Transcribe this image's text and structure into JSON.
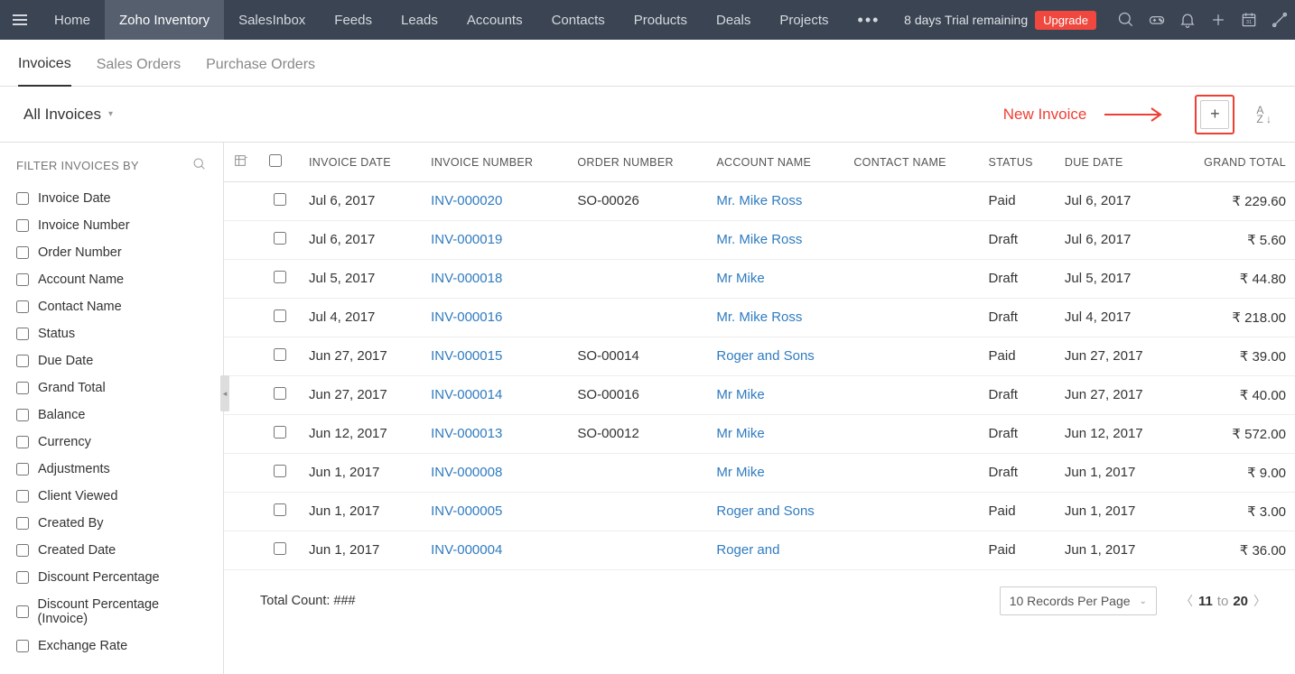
{
  "topnav": {
    "tabs": [
      "Home",
      "Zoho Inventory",
      "SalesInbox",
      "Feeds",
      "Leads",
      "Accounts",
      "Contacts",
      "Products",
      "Deals",
      "Projects"
    ],
    "active_index": 1,
    "more": "•••",
    "trial_text": "8 days Trial remaining",
    "upgrade": "Upgrade"
  },
  "subtabs": {
    "items": [
      "Invoices",
      "Sales Orders",
      "Purchase Orders"
    ],
    "active_index": 0
  },
  "toolbar": {
    "view": "All Invoices",
    "new_invoice_label": "New Invoice"
  },
  "sidebar": {
    "title": "FILTER INVOICES BY",
    "filters": [
      "Invoice Date",
      "Invoice Number",
      "Order Number",
      "Account Name",
      "Contact Name",
      "Status",
      "Due Date",
      "Grand Total",
      "Balance",
      "Currency",
      "Adjustments",
      "Client Viewed",
      "Created By",
      "Created Date",
      "Discount Percentage",
      "Discount Percentage (Invoice)",
      "Exchange Rate"
    ]
  },
  "table": {
    "headers": {
      "invoice_date": "INVOICE DATE",
      "invoice_number": "INVOICE NUMBER",
      "order_number": "ORDER NUMBER",
      "account_name": "ACCOUNT NAME",
      "contact_name": "CONTACT NAME",
      "status": "STATUS",
      "due_date": "DUE DATE",
      "grand_total": "GRAND TOTAL"
    },
    "rows": [
      {
        "date": "Jul 6, 2017",
        "num": "INV-000020",
        "order": "SO-00026",
        "account": "Mr. Mike Ross",
        "contact": "",
        "status": "Paid",
        "due": "Jul 6, 2017",
        "total": "₹ 229.60"
      },
      {
        "date": "Jul 6, 2017",
        "num": "INV-000019",
        "order": "",
        "account": "Mr. Mike Ross",
        "contact": "",
        "status": "Draft",
        "due": "Jul 6, 2017",
        "total": "₹ 5.60"
      },
      {
        "date": "Jul 5, 2017",
        "num": "INV-000018",
        "order": "",
        "account": "Mr Mike",
        "contact": "",
        "status": "Draft",
        "due": "Jul 5, 2017",
        "total": "₹ 44.80"
      },
      {
        "date": "Jul 4, 2017",
        "num": "INV-000016",
        "order": "",
        "account": "Mr. Mike Ross",
        "contact": "",
        "status": "Draft",
        "due": "Jul 4, 2017",
        "total": "₹ 218.00"
      },
      {
        "date": "Jun 27, 2017",
        "num": "INV-000015",
        "order": "SO-00014",
        "account": "Roger and Sons",
        "contact": "",
        "status": "Paid",
        "due": "Jun 27, 2017",
        "total": "₹ 39.00"
      },
      {
        "date": "Jun 27, 2017",
        "num": "INV-000014",
        "order": "SO-00016",
        "account": "Mr Mike",
        "contact": "",
        "status": "Draft",
        "due": "Jun 27, 2017",
        "total": "₹ 40.00"
      },
      {
        "date": "Jun 12, 2017",
        "num": "INV-000013",
        "order": "SO-00012",
        "account": "Mr Mike",
        "contact": "",
        "status": "Draft",
        "due": "Jun 12, 2017",
        "total": "₹ 572.00"
      },
      {
        "date": "Jun 1, 2017",
        "num": "INV-000008",
        "order": "",
        "account": "Mr Mike",
        "contact": "",
        "status": "Draft",
        "due": "Jun 1, 2017",
        "total": "₹ 9.00"
      },
      {
        "date": "Jun 1, 2017",
        "num": "INV-000005",
        "order": "",
        "account": "Roger and Sons",
        "contact": "",
        "status": "Paid",
        "due": "Jun 1, 2017",
        "total": "₹ 3.00"
      },
      {
        "date": "Jun 1, 2017",
        "num": "INV-000004",
        "order": "",
        "account": "Roger and",
        "contact": "",
        "status": "Paid",
        "due": "Jun 1, 2017",
        "total": "₹ 36.00"
      }
    ]
  },
  "footer": {
    "total_count_label": "Total Count: ###",
    "page_size": "10 Records Per Page",
    "pager_from": "11",
    "pager_to_label": "to",
    "pager_to": "20"
  }
}
